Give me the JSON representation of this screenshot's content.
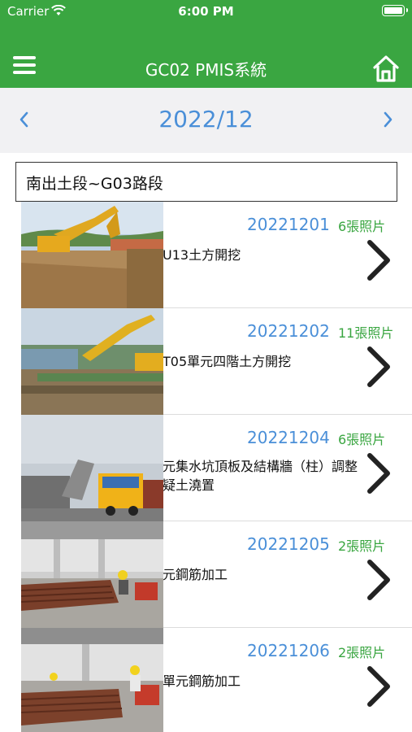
{
  "status_bar": {
    "carrier": "Carrier",
    "time": "6:00 PM"
  },
  "header": {
    "title": "GC02 PMIS系統",
    "menu_icon": "hamburger-icon",
    "home_icon": "home-icon"
  },
  "month_nav": {
    "label": "2022/12",
    "prev_icon": "chevron-left-icon",
    "next_icon": "chevron-right-icon"
  },
  "section": {
    "label": "南出土段~G03路段"
  },
  "entries": [
    {
      "date": "20221201",
      "count": "6張照片",
      "desc_lines": [
        "U13土方開挖"
      ]
    },
    {
      "date": "20221202",
      "count": "11張照片",
      "desc_lines": [
        "T05單元四階土方開挖"
      ]
    },
    {
      "date": "20221204",
      "count": "6張照片",
      "desc_lines": [
        "元集水坑頂板及結構牆（柱）調整",
        "疑土澆置"
      ]
    },
    {
      "date": "20221205",
      "count": "2張照片",
      "desc_lines": [
        "元鋼筋加工"
      ]
    },
    {
      "date": "20221206",
      "count": "2張照片",
      "desc_lines": [
        "單元鋼筋加工"
      ]
    }
  ],
  "colors": {
    "header_green": "#3aa641",
    "accent_blue": "#4a8fd8",
    "count_green": "#3aa641"
  }
}
